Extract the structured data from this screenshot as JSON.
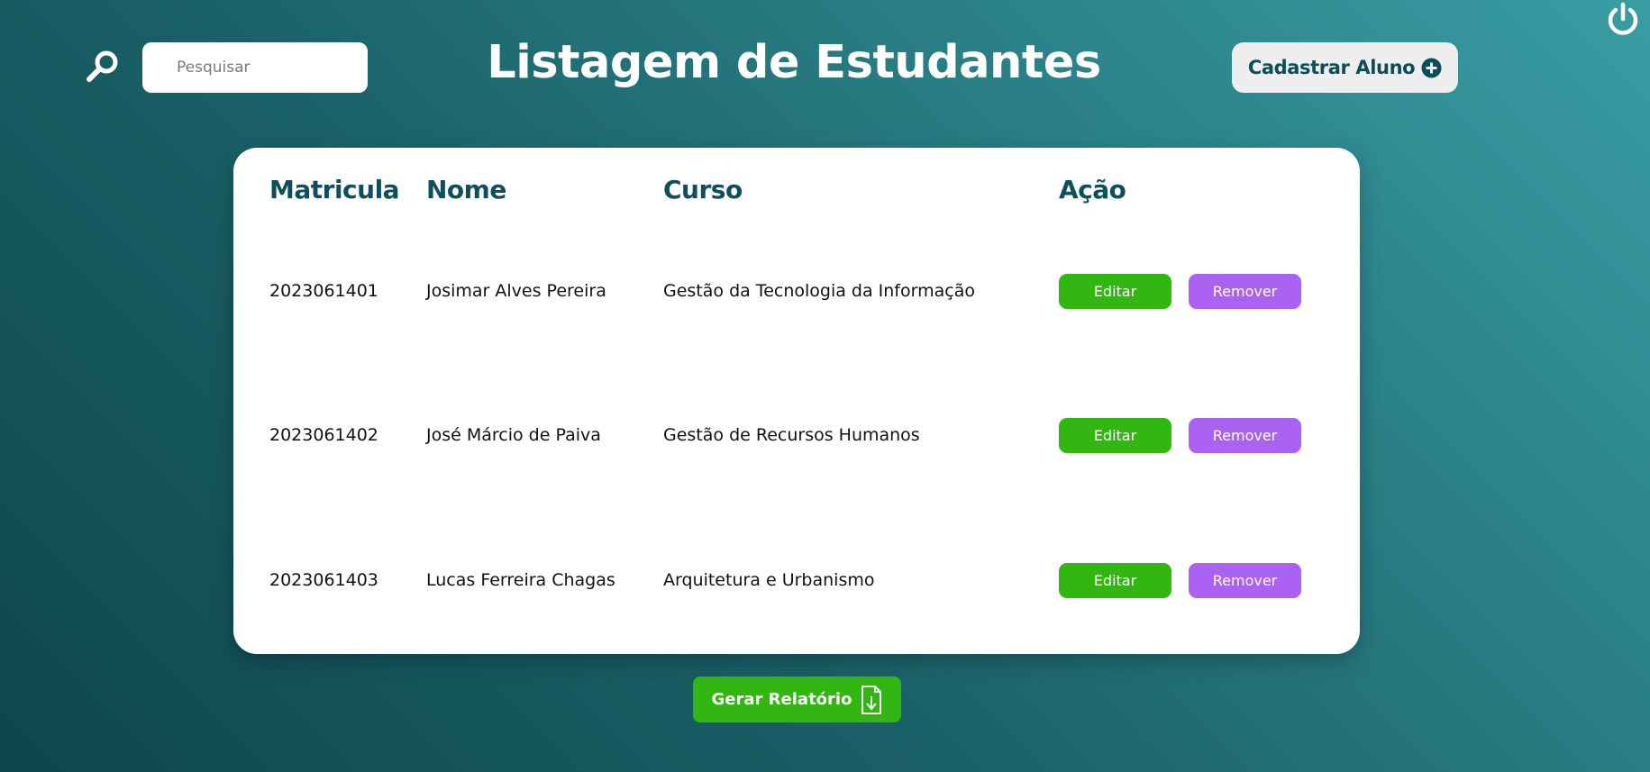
{
  "header": {
    "title": "Listagem de Estudantes",
    "search_placeholder": "Pesquisar",
    "search_icon": "search-icon",
    "add_button_label": "Cadastrar Aluno",
    "add_icon": "plus-circle-icon",
    "power_icon": "power-icon"
  },
  "table": {
    "columns": [
      "Matricula",
      "Nome",
      "Curso",
      "Ação"
    ],
    "rows": [
      {
        "matricula": "2023061401",
        "nome": "Josimar Alves Pereira",
        "curso": "Gestão da Tecnologia da Informação",
        "edit": "Editar",
        "remove": "Remover"
      },
      {
        "matricula": "2023061402",
        "nome": "José Márcio de Paiva",
        "curso": "Gestão de Recursos Humanos",
        "edit": "Editar",
        "remove": "Remover"
      },
      {
        "matricula": "2023061403",
        "nome": "Lucas Ferreira Chagas",
        "curso": "Arquitetura e Urbanismo",
        "edit": "Editar",
        "remove": "Remover"
      }
    ]
  },
  "footer": {
    "report_button_label": "Gerar Relatório",
    "report_icon": "document-download-icon"
  },
  "colors": {
    "primary_dark": "#0e4f5c",
    "edit_green": "#31b612",
    "remove_purple": "#ab62f2",
    "background_light": "#3a9da4",
    "background_dark": "#0d474d"
  }
}
